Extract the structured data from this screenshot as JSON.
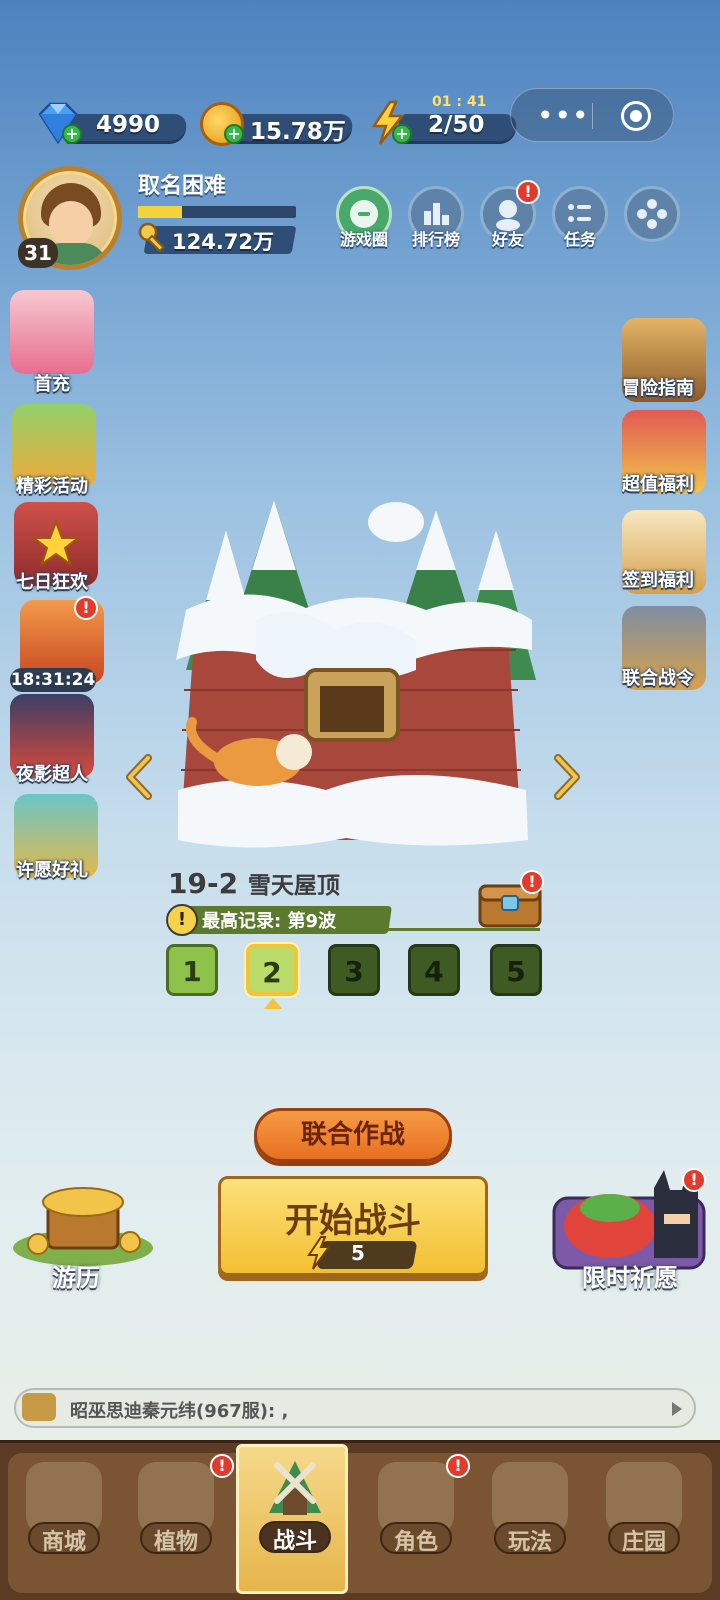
{
  "resources": {
    "gems": "4990",
    "gold": "15.78万",
    "energy": "2/50",
    "energy_timer": "01 : 41"
  },
  "player": {
    "name": "取名困难",
    "level": "31",
    "power": "124.72万",
    "xp_progress": 0.28
  },
  "top_buttons": [
    {
      "label": "游戏圈",
      "icon": "game-circle-icon"
    },
    {
      "label": "排行榜",
      "icon": "leaderboard-icon"
    },
    {
      "label": "好友",
      "icon": "friends-icon",
      "badge": "!"
    },
    {
      "label": "任务",
      "icon": "tasks-icon"
    },
    {
      "label": "",
      "icon": "more-icon"
    }
  ],
  "left_events": [
    {
      "label": "首充",
      "icon": "first-charge-icon"
    },
    {
      "label": "精彩活动",
      "icon": "events-icon"
    },
    {
      "label": "七日狂欢",
      "icon": "seven-day-icon"
    },
    {
      "label": "18:31:24",
      "icon": "gift-box-icon",
      "badge": "!"
    },
    {
      "label": "夜影超人",
      "icon": "night-hero-icon"
    },
    {
      "label": "许愿好礼",
      "icon": "wish-gift-icon"
    }
  ],
  "right_events": [
    {
      "label": "冒险指南",
      "icon": "adventure-guide-icon"
    },
    {
      "label": "超值福利",
      "icon": "value-benefit-icon"
    },
    {
      "label": "签到福利",
      "icon": "check-in-icon"
    },
    {
      "label": "联合战令",
      "icon": "battle-pass-icon"
    }
  ],
  "stage": {
    "number": "19-2",
    "name": "雪天屋顶",
    "record": "最高记录: 第9波",
    "info_glyph": "!",
    "chest_badge": "!",
    "waves": [
      "1",
      "2",
      "3",
      "4",
      "5"
    ],
    "active_wave": 2
  },
  "buttons": {
    "coop": "联合作战",
    "start": "开始战斗",
    "start_cost": "5",
    "travel": "游历",
    "wish": "限时祈愿",
    "wish_badge": "!"
  },
  "chat": {
    "message": "昭巫思迪秦元纬(967服): ,"
  },
  "nav": [
    {
      "label": "商城",
      "icon": "shop-icon"
    },
    {
      "label": "植物",
      "icon": "plants-icon",
      "badge": "!"
    },
    {
      "label": "战斗",
      "icon": "battle-icon",
      "active": true
    },
    {
      "label": "角色",
      "icon": "character-icon",
      "badge": "!"
    },
    {
      "label": "玩法",
      "icon": "gameplay-icon"
    },
    {
      "label": "庄园",
      "icon": "manor-icon"
    }
  ],
  "colors": {
    "accent_gold": "#f3bf32",
    "coop_orange": "#e86f22",
    "badge_red": "#e23a2c",
    "wave_green": "#8ec24b"
  }
}
